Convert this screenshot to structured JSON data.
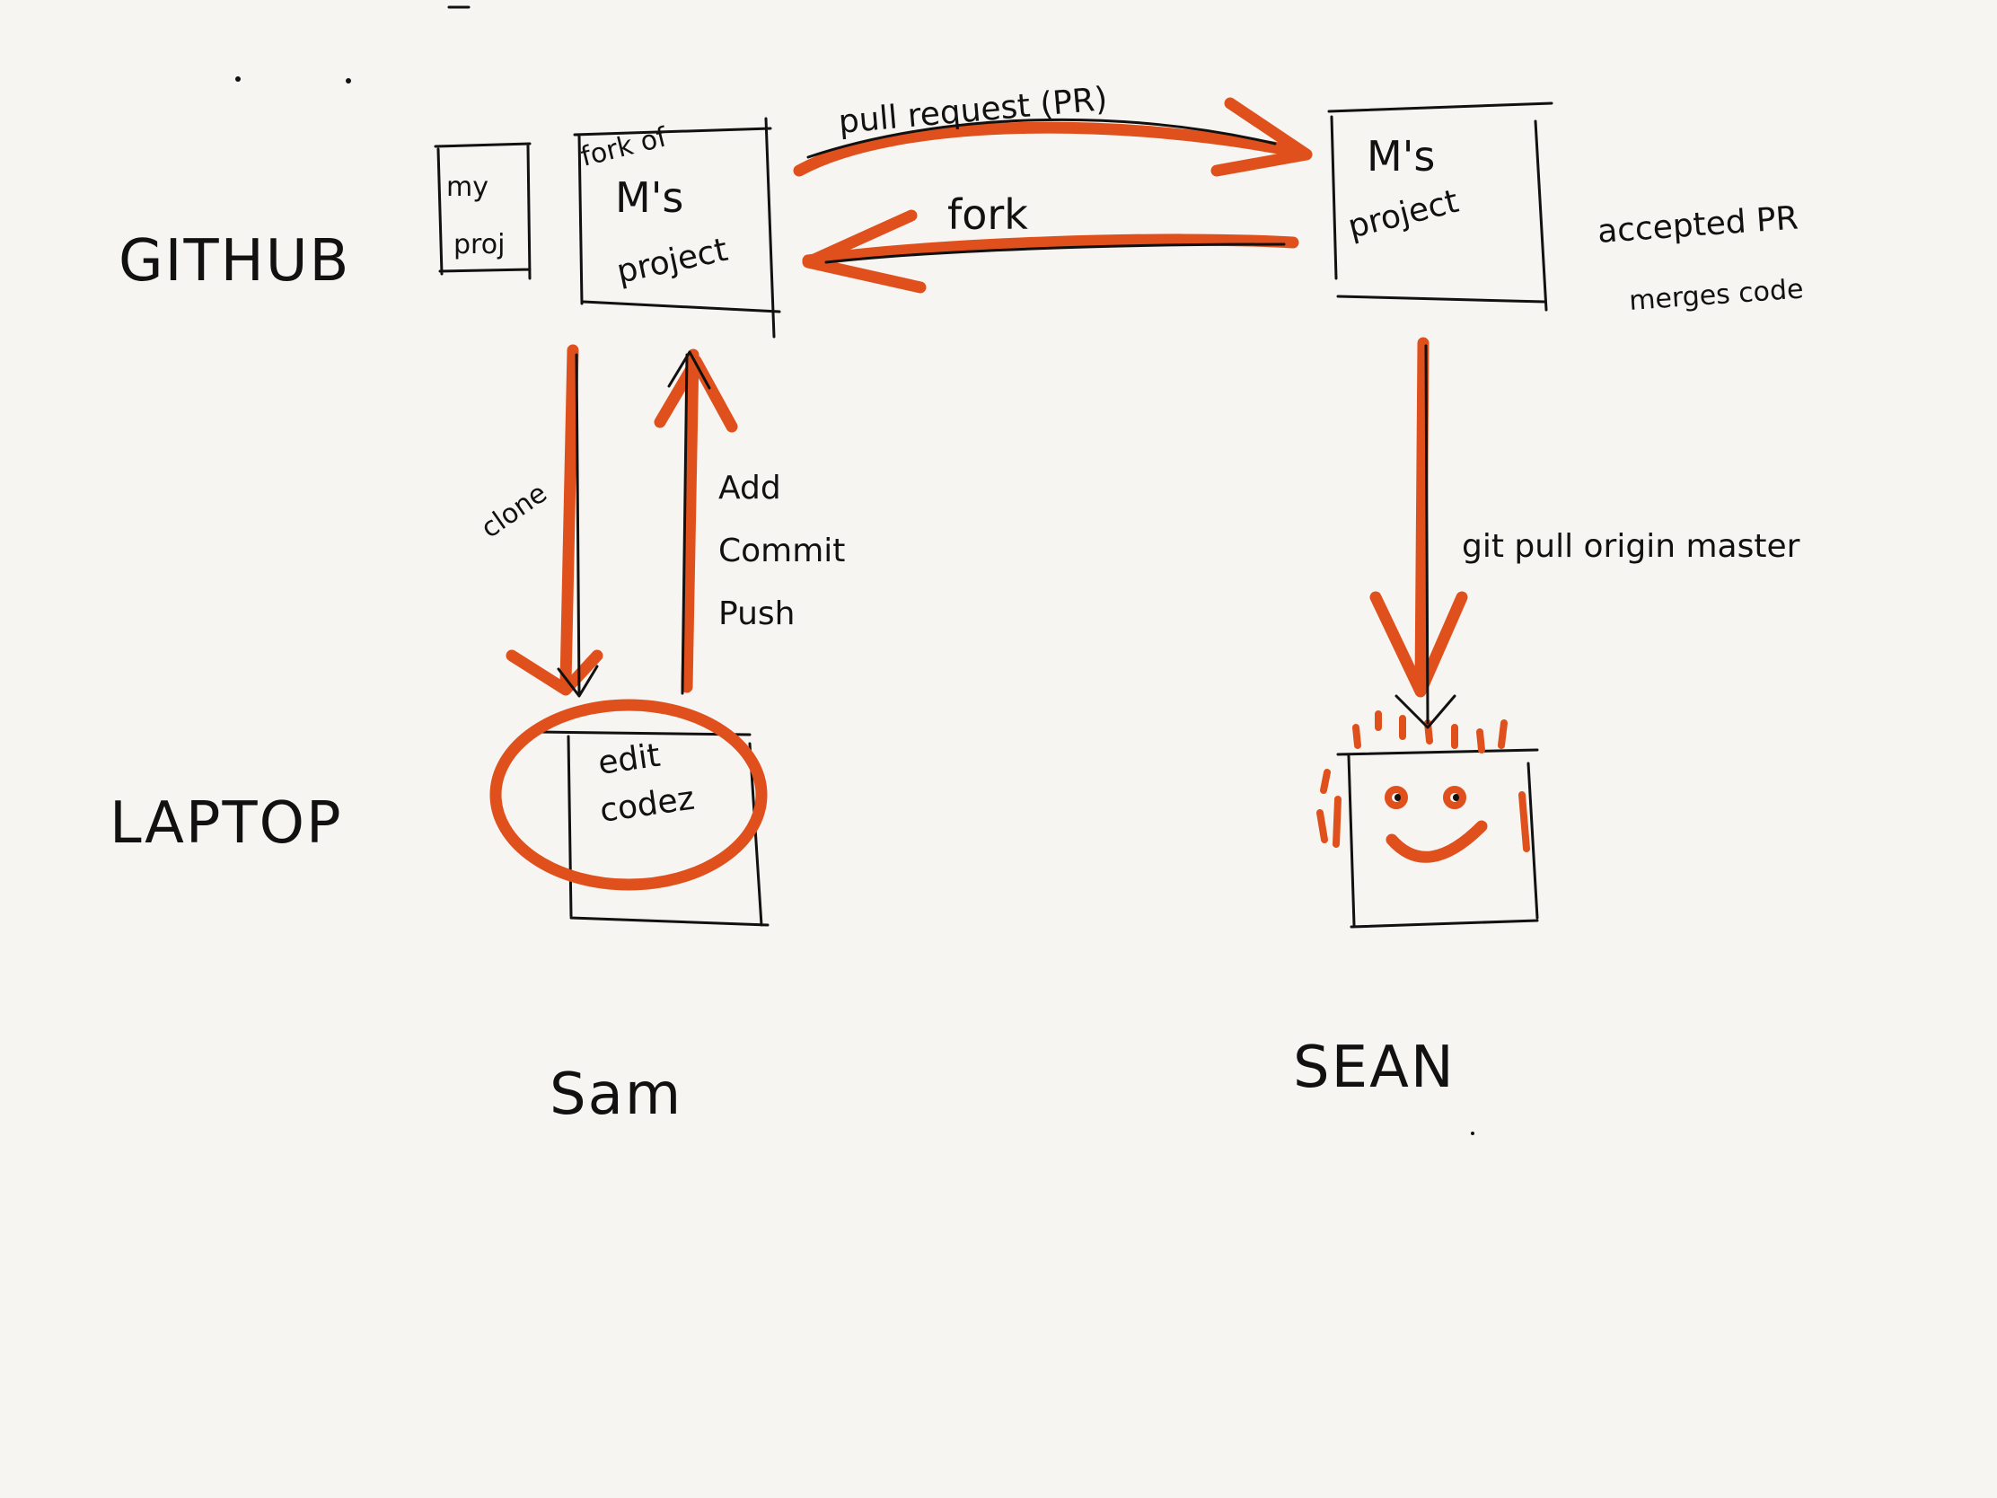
{
  "diagram": {
    "rows": {
      "github": "GITHUB",
      "laptop": "LAPTOP"
    },
    "boxes": {
      "my_proj_line1": "my",
      "my_proj_line2": "proj",
      "fork_title": "fork of",
      "fork_line1": "M's",
      "fork_line2": "project",
      "m_project_line1": "M's",
      "m_project_line2": "project",
      "laptop_line1": "edit",
      "laptop_line2": "codez"
    },
    "edges": {
      "pull_request": "pull request (PR)",
      "fork": "fork",
      "clone": "clone",
      "add": "Add",
      "commit": "Commit",
      "push": "Push",
      "git_pull": "git pull origin master"
    },
    "notes": {
      "accepted_line1": "accepted PR",
      "accepted_line2": "merges code"
    },
    "people": {
      "sam": "Sam",
      "sean": "SEAN"
    },
    "colors": {
      "ink": "#111111",
      "accent": "#e0501c",
      "background": "#f6f5f1"
    }
  }
}
